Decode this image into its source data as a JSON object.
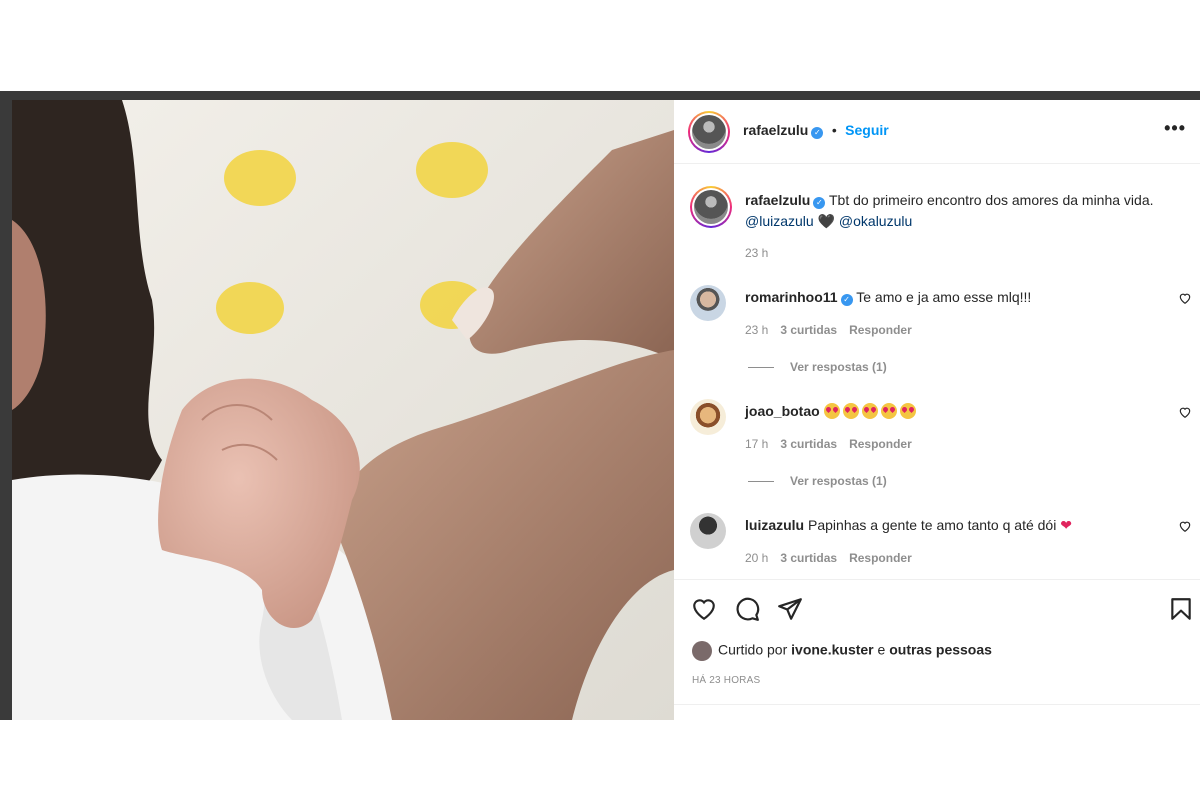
{
  "post": {
    "username": "rafaelzulu",
    "follow_label": "Seguir",
    "separator": "•",
    "more_label": "•••"
  },
  "caption": {
    "username": "rafaelzulu",
    "text": "Tbt do primeiro encontro dos amores da minha vida.",
    "mention1": "@luizazulu",
    "heart": "🖤",
    "mention2": "@okaluzulu",
    "time": "23 h"
  },
  "comments": [
    {
      "username": "romarinhoo11",
      "verified": true,
      "text": "Te amo e ja amo esse mlq!!!",
      "time": "23 h",
      "likes": "3 curtidas",
      "reply": "Responder",
      "view_replies": "Ver respostas (1)"
    },
    {
      "username": "joao_botao",
      "verified": false,
      "text": "",
      "emoji_count": 5,
      "time": "17 h",
      "likes": "3 curtidas",
      "reply": "Responder",
      "view_replies": "Ver respostas (1)"
    },
    {
      "username": "luizazulu",
      "verified": false,
      "text": "Papinhas a gente te amo tanto q até dói",
      "heart": "❤",
      "time": "20 h",
      "likes": "3 curtidas",
      "reply": "Responder"
    }
  ],
  "likes": {
    "prefix": "Curtido por",
    "user": "ivone.kuster",
    "conj": "e",
    "others": "outras pessoas"
  },
  "posted_ago": "HÁ 23 HORAS",
  "icons": [
    "heart-icon",
    "comment-icon",
    "share-icon",
    "bookmark-icon",
    "verified-icon",
    "more-icon"
  ],
  "colors": {
    "accent": "#0095f6",
    "verified": "#3897f0",
    "muted": "#8e8e8e"
  }
}
